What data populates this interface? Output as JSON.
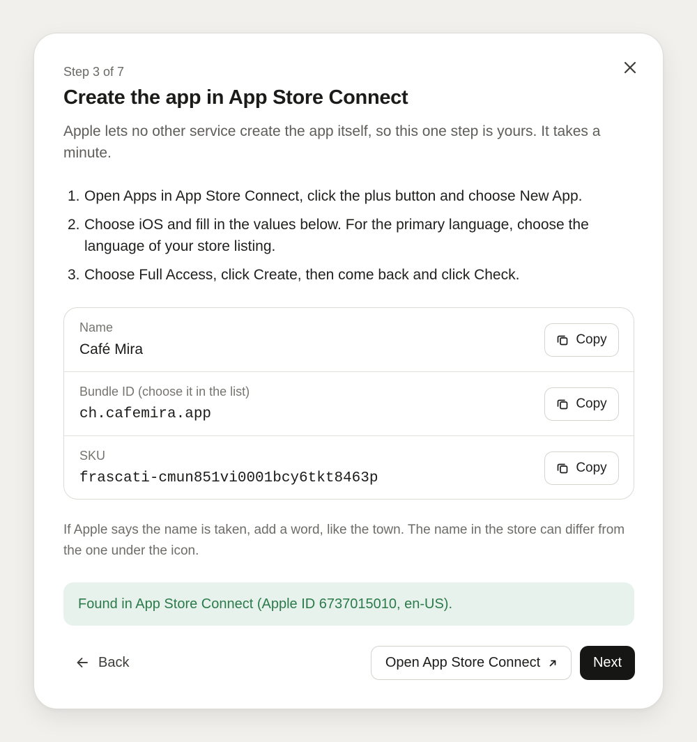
{
  "dialog": {
    "step_label": "Step 3 of 7",
    "title": "Create the app in App Store Connect",
    "intro": "Apple lets no other service create the app itself, so this one step is yours. It takes a minute.",
    "close_icon": "close-icon"
  },
  "instructions": [
    {
      "num": "1.",
      "text": "Open Apps in App Store Connect, click the plus button and choose New App."
    },
    {
      "num": "2.",
      "text": "Choose iOS and fill in the values below. For the primary language, choose the language of your store listing."
    },
    {
      "num": "3.",
      "text": "Choose Full Access, click Create, then come back and click Check."
    }
  ],
  "fields": [
    {
      "label": "Name",
      "value": "Café Mira",
      "copy_label": "Copy"
    },
    {
      "label": "Bundle ID (choose it in the list)",
      "value": "ch.cafemira.app",
      "copy_label": "Copy"
    },
    {
      "label": "SKU",
      "value": "frascati-cmun851vi0001bcy6tkt8463p",
      "copy_label": "Copy"
    }
  ],
  "note": "If Apple says the name is taken, add a word, like the town. The name in the store can differ from the one under the icon.",
  "status": {
    "text": "Found in App Store Connect (Apple ID 6737015010, en-US).",
    "color": "#2b7a4b",
    "background": "#e8f2ec"
  },
  "footer": {
    "back_label": "Back",
    "open_label": "Open App Store Connect",
    "next_label": "Next"
  },
  "colors": {
    "primary_button": "#161615",
    "page_background": "#f1f0ed"
  }
}
